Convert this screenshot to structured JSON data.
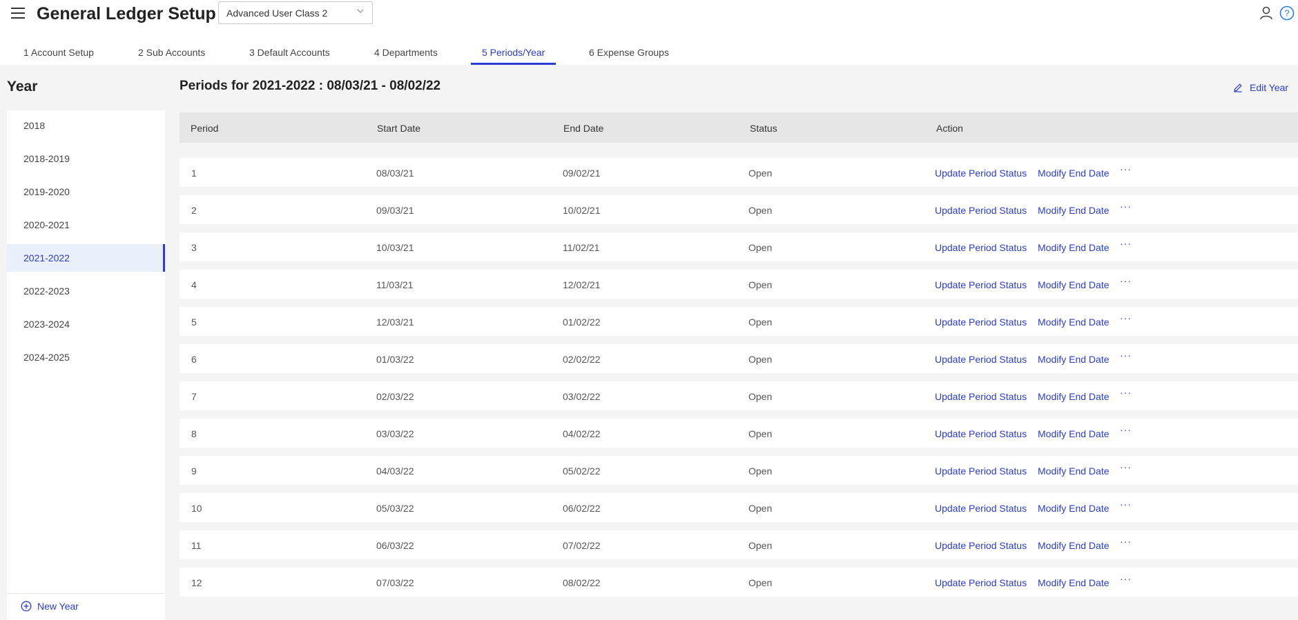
{
  "header": {
    "title": "General Ledger Setup",
    "class_select": {
      "value": "Advanced User Class 2"
    },
    "icons": [
      "menu-icon",
      "user-icon",
      "help-icon",
      "chevron-down-icon"
    ]
  },
  "tabs": [
    {
      "label": "1 Account Setup",
      "active": false
    },
    {
      "label": "2 Sub Accounts",
      "active": false
    },
    {
      "label": "3 Default Accounts",
      "active": false
    },
    {
      "label": "4 Departments",
      "active": false
    },
    {
      "label": "5 Periods/Year",
      "active": true
    },
    {
      "label": "6 Expense Groups",
      "active": false
    }
  ],
  "sidebar": {
    "title": "Year",
    "years": [
      {
        "label": "2018",
        "active": false
      },
      {
        "label": "2018-2019",
        "active": false
      },
      {
        "label": "2019-2020",
        "active": false
      },
      {
        "label": "2020-2021",
        "active": false
      },
      {
        "label": "2021-2022",
        "active": true
      },
      {
        "label": "2022-2023",
        "active": false
      },
      {
        "label": "2023-2024",
        "active": false
      },
      {
        "label": "2024-2025",
        "active": false
      }
    ],
    "new_year_label": "New Year"
  },
  "main": {
    "title": "Periods for 2021-2022 : 08/03/21 - 08/02/22",
    "edit_year_label": "Edit Year",
    "columns": [
      "Period",
      "Start Date",
      "End Date",
      "Status",
      "Action"
    ],
    "action_labels": {
      "update": "Update Period Status",
      "modify": "Modify End Date",
      "more": "···"
    },
    "rows": [
      {
        "period": "1",
        "start": "08/03/21",
        "end": "09/02/21",
        "status": "Open"
      },
      {
        "period": "2",
        "start": "09/03/21",
        "end": "10/02/21",
        "status": "Open"
      },
      {
        "period": "3",
        "start": "10/03/21",
        "end": "11/02/21",
        "status": "Open"
      },
      {
        "period": "4",
        "start": "11/03/21",
        "end": "12/02/21",
        "status": "Open"
      },
      {
        "period": "5",
        "start": "12/03/21",
        "end": "01/02/22",
        "status": "Open"
      },
      {
        "period": "6",
        "start": "01/03/22",
        "end": "02/02/22",
        "status": "Open"
      },
      {
        "period": "7",
        "start": "02/03/22",
        "end": "03/02/22",
        "status": "Open"
      },
      {
        "period": "8",
        "start": "03/03/22",
        "end": "04/02/22",
        "status": "Open"
      },
      {
        "period": "9",
        "start": "04/03/22",
        "end": "05/02/22",
        "status": "Open"
      },
      {
        "period": "10",
        "start": "05/03/22",
        "end": "06/02/22",
        "status": "Open"
      },
      {
        "period": "11",
        "start": "06/03/22",
        "end": "07/02/22",
        "status": "Open"
      },
      {
        "period": "12",
        "start": "07/03/22",
        "end": "08/02/22",
        "status": "Open"
      }
    ]
  },
  "colors": {
    "accent": "#2a3bd1",
    "active_bg": "#e9f0fc",
    "body_bg": "#f4f4f4",
    "header_row_bg": "#e6e6e6"
  }
}
